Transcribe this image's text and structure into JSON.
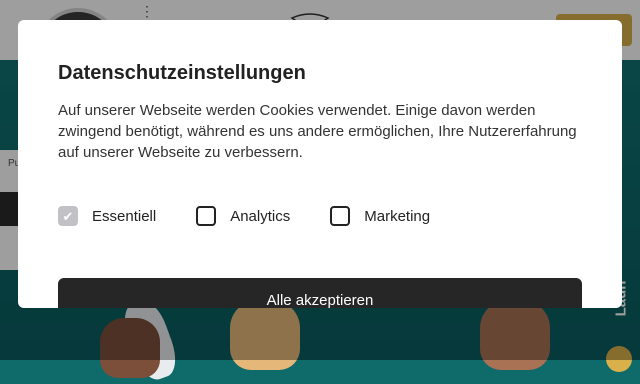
{
  "background": {
    "side_card_text": "Pu",
    "launch_label": "Laun"
  },
  "consent": {
    "title": "Datenschutzeinstellungen",
    "description": "Auf unserer Webseite werden Cookies verwendet. Einige davon werden zwingend benötigt, während es uns andere ermöglichen, Ihre Nutzererfahrung auf unserer Webseite zu verbessern.",
    "options": [
      {
        "label": "Essentiell",
        "checked": true,
        "disabled": true
      },
      {
        "label": "Analytics",
        "checked": false,
        "disabled": false
      },
      {
        "label": "Marketing",
        "checked": false,
        "disabled": false
      }
    ],
    "accept_all_label": "Alle akzeptieren"
  },
  "colors": {
    "accent_gold": "#d9b04a",
    "button_dark": "#262626",
    "sea_teal": "#0f6a6a"
  }
}
